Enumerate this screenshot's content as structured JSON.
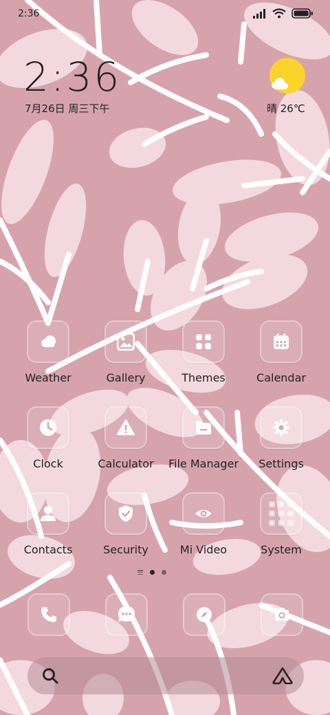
{
  "status_bar": {
    "time": "2:36",
    "icons": [
      "signal-icon",
      "wifi-icon",
      "battery-icon"
    ]
  },
  "clock_widget": {
    "time": "2:36",
    "date": "7月26日 周三下午"
  },
  "weather_widget": {
    "icon": "partly-sunny-icon",
    "text": "晴 26℃"
  },
  "apps": [
    {
      "label": "Weather",
      "icon": "weather-icon"
    },
    {
      "label": "Gallery",
      "icon": "gallery-icon"
    },
    {
      "label": "Themes",
      "icon": "themes-icon"
    },
    {
      "label": "Calendar",
      "icon": "calendar-icon"
    },
    {
      "label": "Clock",
      "icon": "clock-icon"
    },
    {
      "label": "Calculator",
      "icon": "calculator-icon"
    },
    {
      "label": "File Manager",
      "icon": "file-manager-icon"
    },
    {
      "label": "Settings",
      "icon": "settings-icon"
    },
    {
      "label": "Contacts",
      "icon": "contacts-icon"
    },
    {
      "label": "Security",
      "icon": "security-icon"
    },
    {
      "label": "Mi Video",
      "icon": "mi-video-icon"
    },
    {
      "label": "System",
      "icon": "system-folder-icon"
    }
  ],
  "pager": {
    "pages": 2,
    "active": 1
  },
  "dock": [
    {
      "icon": "phone-icon"
    },
    {
      "icon": "messages-icon"
    },
    {
      "icon": "browser-icon"
    },
    {
      "icon": "camera-icon"
    }
  ],
  "search_bar": {
    "left_icon": "search-icon",
    "right_icon": "assistant-icon"
  },
  "colors": {
    "background": "#d6a3ad",
    "leaf_light": "#f2d8dc",
    "branch": "#ffffff",
    "sun": "#fcd32b"
  }
}
